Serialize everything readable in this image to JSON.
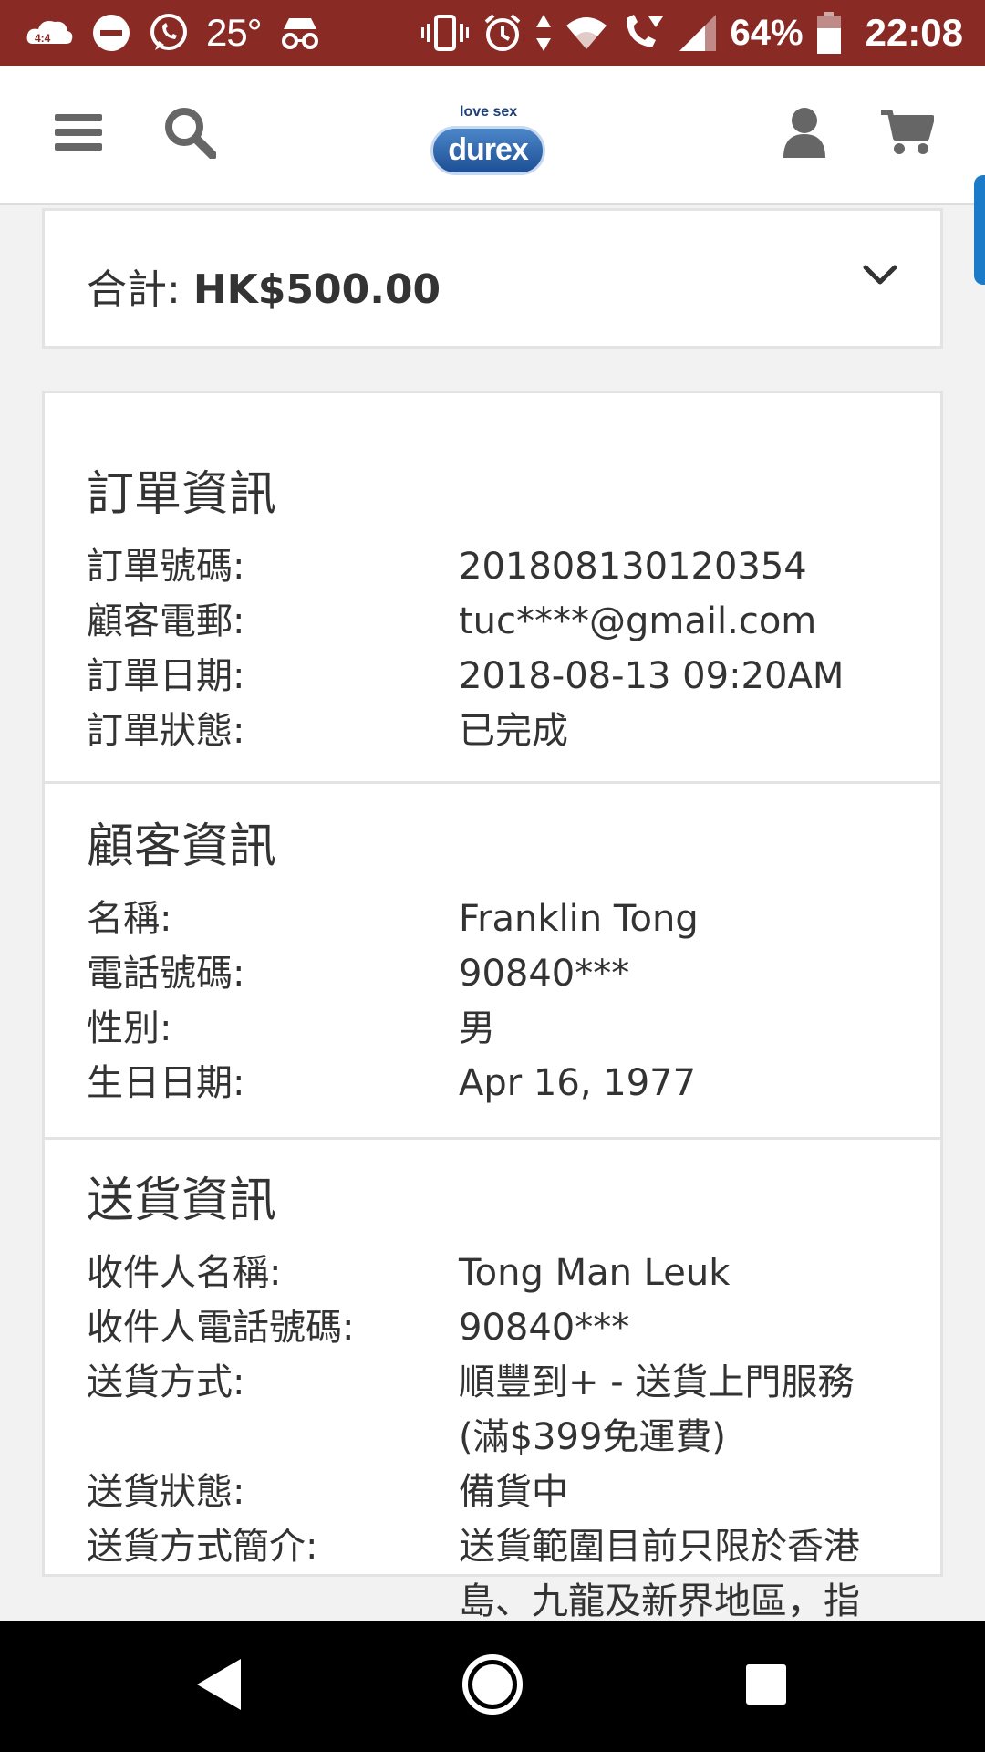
{
  "status_bar": {
    "temperature": "25°",
    "battery_percent": "64%",
    "time": "22:08"
  },
  "header": {
    "logo_tagline": "love sex",
    "logo_text": "durex"
  },
  "total": {
    "label": "合計: ",
    "amount": "HK$500.00"
  },
  "order_info": {
    "title": "訂單資訊",
    "rows": [
      {
        "label": "訂單號碼:",
        "value": "201808130120354"
      },
      {
        "label": "顧客電郵:",
        "value": "tuc****@gmail.com"
      },
      {
        "label": "訂單日期:",
        "value": "2018-08-13 09:20AM"
      },
      {
        "label": "訂單狀態:",
        "value": "已完成"
      }
    ]
  },
  "customer_info": {
    "title": "顧客資訊",
    "rows": [
      {
        "label": "名稱:",
        "value": "Franklin Tong"
      },
      {
        "label": "電話號碼:",
        "value": "90840***"
      },
      {
        "label": "性別:",
        "value": "男"
      },
      {
        "label": "生日日期:",
        "value": "Apr 16, 1977"
      }
    ]
  },
  "delivery_info": {
    "title": "送貨資訊",
    "rows": [
      {
        "label": "收件人名稱:",
        "value": "Tong Man Leuk"
      },
      {
        "label": "收件人電話號碼:",
        "value": "90840***"
      },
      {
        "label": "送貨方式:",
        "value": "順豐到+ - 送貨上門服務",
        "value2": "(滿$399免運費)"
      },
      {
        "label": "送貨狀態:",
        "value": "備貨中"
      },
      {
        "label": "送貨方式簡介:",
        "value": "送貨範圍目前只限於香港",
        "value2": "島、九龍及新界地區，指"
      }
    ]
  },
  "icons": {
    "menu": "hamburger-icon",
    "search": "search-icon",
    "account": "user-icon",
    "cart": "cart-icon",
    "expand": "chevron-down-icon"
  },
  "colors": {
    "status_bar": "#8a2a25",
    "header_icons": "#666666",
    "accent_tab": "#1c7bc9"
  }
}
